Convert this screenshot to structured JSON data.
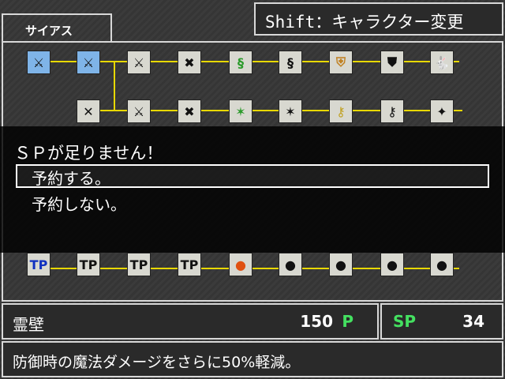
{
  "character_tab": "サイアス",
  "shift_hint": "Shift：キャラクター変更",
  "dialog": {
    "message": "ＳＰが足りません！",
    "options": [
      "予約する。",
      "予約しない。"
    ],
    "selected_index": 0
  },
  "grid_rows": [
    {
      "row": 1,
      "nodes": [
        "sword-selected",
        "sword-selected",
        "sword",
        "sword-dark",
        "green-whip",
        "whip-dark",
        "shield",
        "shield-dark",
        "rabbit"
      ]
    },
    {
      "row": 2,
      "nodes": [
        "double-sword",
        "sword",
        "sword-dark",
        "green-cross",
        "cross-dark",
        "key",
        "key-dark",
        "wolf-dark"
      ]
    },
    {
      "row": 5,
      "nodes": [
        "tp",
        "tp",
        "tp",
        "tp",
        "orange-orb",
        "black-orb",
        "black-orb",
        "black-orb",
        "black-orb"
      ]
    }
  ],
  "node_labels": {
    "tp": "TP"
  },
  "skill": {
    "name": "霊壁",
    "cost": "150",
    "unit": "P"
  },
  "sp": {
    "label": "SP",
    "value": "34"
  },
  "description": "防御時の魔法ダメージをさらに50%軽減。"
}
